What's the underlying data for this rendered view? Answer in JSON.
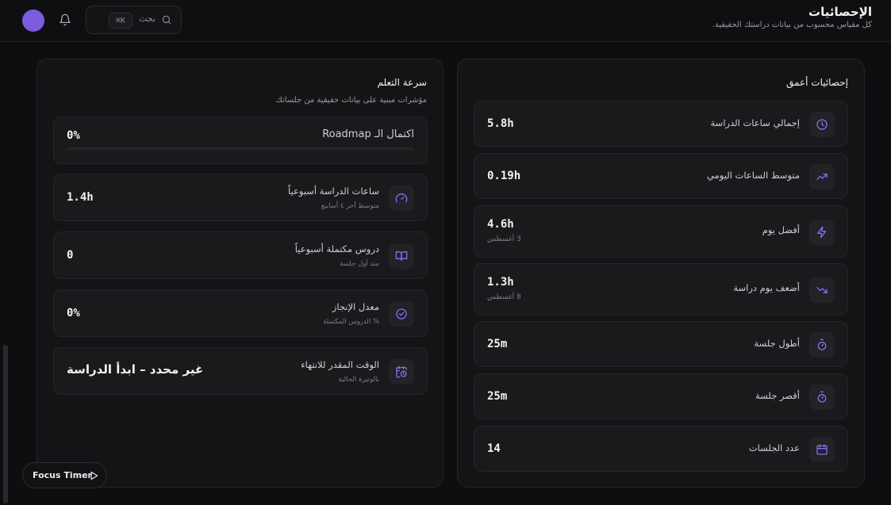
{
  "header": {
    "title": "الإحصائيات",
    "subtitle": "كل مقياس محسوب من بيانات دراستك الحقيقية.",
    "search_placeholder": "بحث",
    "search_shortcut": "⌘K"
  },
  "learning_speed": {
    "title": "سرعة التعلم",
    "subtitle": "مؤشرات مبنية على بيانات حقيقية من جلساتك",
    "roadmap": {
      "label": "اكتمال الـ Roadmap",
      "value": "0%",
      "progress": 0
    },
    "cards": [
      {
        "label": "ساعات الدراسة أسبوعياً",
        "sub": "متوسط آخر ٤ أسابيع",
        "value": "1.4h",
        "icon": "gauge-icon"
      },
      {
        "label": "دروس مكتملة أسبوعياً",
        "sub": "منذ أول جلسة",
        "value": "0",
        "icon": "book-icon"
      },
      {
        "label": "معدل الإنجاز",
        "sub": "% الدروس المكتملة",
        "value": "0%",
        "icon": "check-circle-icon"
      },
      {
        "label": "الوقت المقدر للانتهاء",
        "sub": "بالوتيرة الحالية",
        "value": "غير محدد – ابدأ الدراسة",
        "icon": "calendar-clock-icon"
      }
    ]
  },
  "detailed_stats": {
    "title": "إحصائيات أعمق",
    "rows": [
      {
        "label": "إجمالي ساعات الدراسة",
        "value": "5.8h",
        "sub": "",
        "icon": "clock-icon"
      },
      {
        "label": "متوسط الساعات اليومي",
        "value": "0.19h",
        "sub": "",
        "icon": "trending-up-icon"
      },
      {
        "label": "أفضل يوم",
        "value": "4.6h",
        "sub": "3 أغسطس",
        "icon": "lightning-icon"
      },
      {
        "label": "أضعف يوم دراسة",
        "value": "1.3h",
        "sub": "8 أغسطس",
        "icon": "trending-down-icon"
      },
      {
        "label": "أطول جلسة",
        "value": "25m",
        "sub": "",
        "icon": "stopwatch-icon"
      },
      {
        "label": "أقصر جلسة",
        "value": "25m",
        "sub": "",
        "icon": "stopwatch-icon"
      },
      {
        "label": "عدد الجلسات",
        "value": "14",
        "sub": "",
        "icon": "calendar-icon"
      }
    ]
  },
  "focus_timer": {
    "label": "Focus Timer"
  },
  "colors": {
    "accent": "#7c5ce0",
    "background": "#0e0e10",
    "panel": "#141416",
    "card": "#1a1a1d"
  }
}
